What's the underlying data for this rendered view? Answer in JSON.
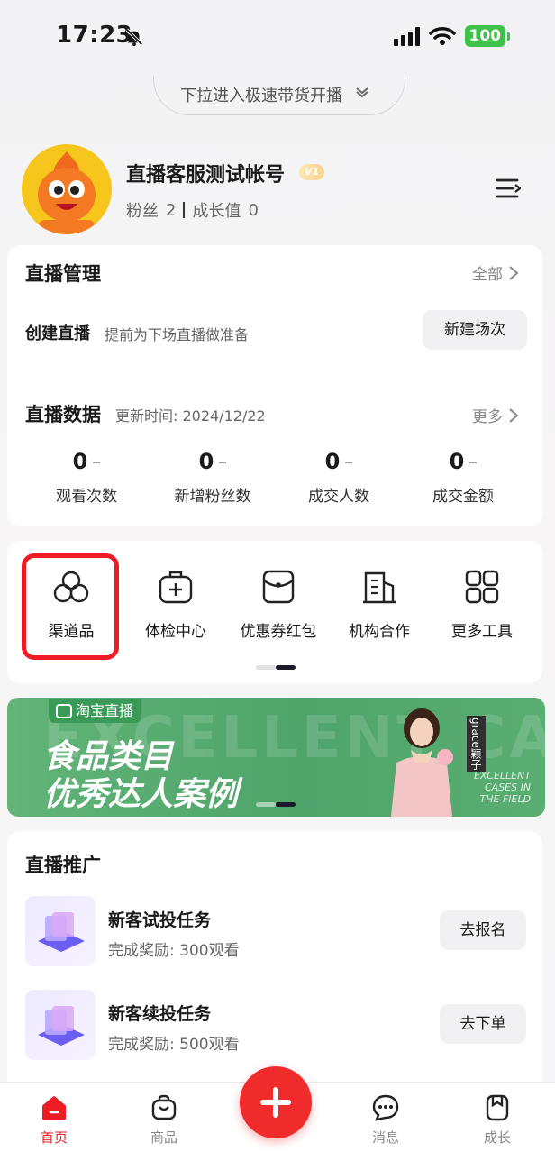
{
  "status_bar": {
    "time": "17:23",
    "battery": "100"
  },
  "pull_banner": {
    "text": "下拉进入极速带货开播"
  },
  "profile": {
    "name": "直播客服测试帐号",
    "level_badge": "V1",
    "fans_label": "粉丝",
    "fans_count": "2",
    "growth_label": "成长值",
    "growth_value": "0"
  },
  "live_management": {
    "title": "直播管理",
    "more_label": "全部",
    "create_label": "创建直播",
    "create_desc": "提前为下场直播做准备",
    "create_button": "新建场次"
  },
  "live_data": {
    "title": "直播数据",
    "update_text": "更新时间: 2024/12/22",
    "more_label": "更多",
    "metrics": [
      {
        "value": "0",
        "label": "观看次数"
      },
      {
        "value": "0",
        "label": "新增粉丝数"
      },
      {
        "value": "0",
        "label": "成交人数"
      },
      {
        "value": "0",
        "label": "成交金额"
      }
    ]
  },
  "tools": [
    {
      "label": "渠道品",
      "icon": "three-circles-icon"
    },
    {
      "label": "体检中心",
      "icon": "medical-kit-icon"
    },
    {
      "label": "优惠券红包",
      "icon": "red-envelope-icon"
    },
    {
      "label": "机构合作",
      "icon": "building-icon"
    },
    {
      "label": "更多工具",
      "icon": "grid-icon"
    }
  ],
  "banner": {
    "tag": "淘宝直播",
    "bg_text": "EXCELLENT CASE",
    "line1": "食品类目",
    "line2": "优秀达人案例",
    "person_name": "grace颖子",
    "cases_text": [
      "EXCELLENT",
      "CASES IN",
      "THE FIELD"
    ]
  },
  "promotion": {
    "title": "直播推广",
    "items": [
      {
        "title": "新客试投任务",
        "reward": "完成奖励: 300观看",
        "button": "去报名"
      },
      {
        "title": "新客续投任务",
        "reward": "完成奖励: 500观看",
        "button": "去下单"
      }
    ]
  },
  "tab_bar": {
    "items": [
      {
        "label": "首页",
        "icon": "home-icon",
        "active": true
      },
      {
        "label": "商品",
        "icon": "shopping-bag-icon",
        "active": false
      },
      {
        "label": "消息",
        "icon": "message-icon",
        "active": false
      },
      {
        "label": "成长",
        "icon": "growth-icon",
        "active": false
      }
    ],
    "fab_icon": "plus-icon"
  },
  "colors": {
    "accent": "#ee1c25",
    "battery": "#3ec24a",
    "banner_green": "#4ea46a",
    "avatar_yellow": "#f7c61c"
  }
}
